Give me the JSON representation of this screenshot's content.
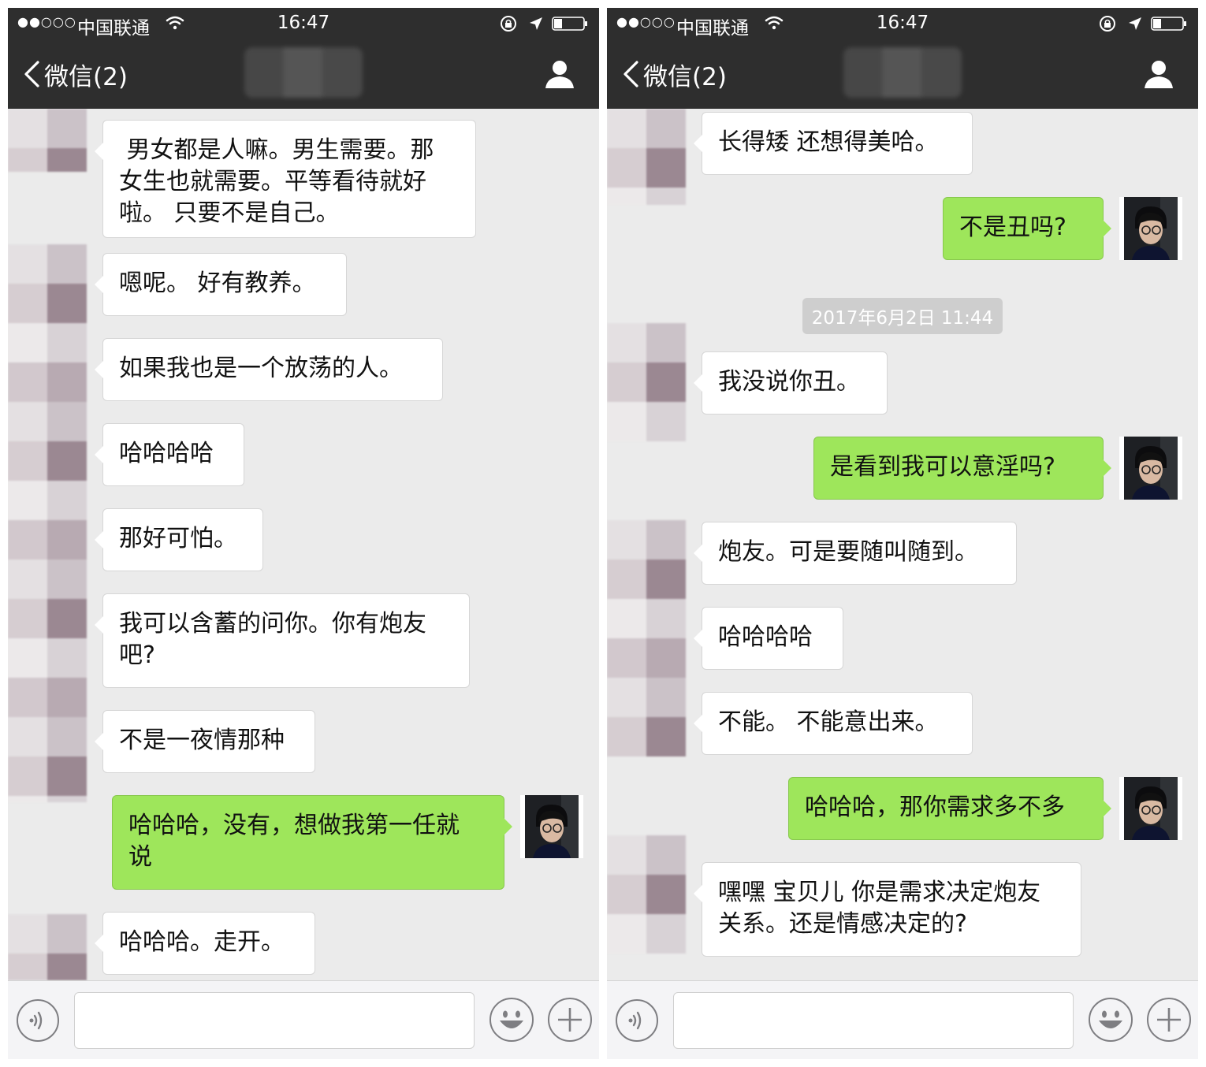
{
  "status_bar": {
    "signal": "●●○○○",
    "carrier": "中国联通",
    "time": "16:47"
  },
  "nav": {
    "back_label": "微信(2)"
  },
  "left_chat": {
    "messages": [
      {
        "side": "in",
        "text": " 男女都是人嘛。男生需要。那\n女生也就需要。平等看待就好\n啦。 只要不是自己。"
      },
      {
        "side": "in",
        "text": "嗯呢。 好有教养。"
      },
      {
        "side": "in",
        "text": "如果我也是一个放荡的人。"
      },
      {
        "side": "in",
        "text": "哈哈哈哈"
      },
      {
        "side": "in",
        "text": "那好可怕。"
      },
      {
        "side": "in",
        "text": "我可以含蓄的问你。你有炮友\n吧?"
      },
      {
        "side": "in",
        "text": "不是一夜情那种"
      },
      {
        "side": "out",
        "text": "哈哈哈，没有，想做我第一任就\n说"
      },
      {
        "side": "in",
        "text": "哈哈哈。走开。"
      }
    ]
  },
  "right_chat": {
    "timestamp": "2017年6月2日 11:44",
    "messages": [
      {
        "side": "in",
        "text": "长得矮 还想得美哈。"
      },
      {
        "side": "out",
        "text": "不是丑吗?"
      },
      {
        "side": "in",
        "text": "我没说你丑。"
      },
      {
        "side": "out",
        "text": "是看到我可以意淫吗?"
      },
      {
        "side": "in",
        "text": "炮友。可是要随叫随到。"
      },
      {
        "side": "in",
        "text": "哈哈哈哈"
      },
      {
        "side": "in",
        "text": "不能。 不能意出来。"
      },
      {
        "side": "out",
        "text": "哈哈哈，那你需求多不多"
      },
      {
        "side": "in",
        "text": "嘿嘿 宝贝儿 你是需求决定炮友\n关系。还是情感决定的?"
      }
    ]
  },
  "input_bar": {
    "placeholder": ""
  },
  "colors": {
    "nav_bg": "#2e2e2e",
    "chat_bg": "#ebebeb",
    "outgoing_bubble": "#9ee65b",
    "incoming_bubble": "#ffffff"
  }
}
